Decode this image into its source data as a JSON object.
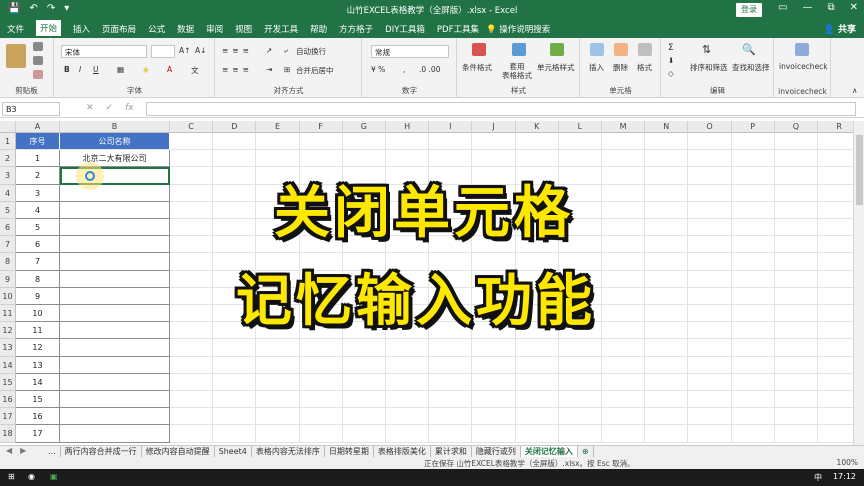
{
  "window": {
    "title": "山竹EXCEL表格教学（全屏版）.xlsx  -  Excel",
    "login_label": "登录",
    "controls": [
      "—",
      "▢",
      "⧉",
      "✕"
    ]
  },
  "menu": {
    "tabs": [
      "文件",
      "开始",
      "插入",
      "页面布局",
      "公式",
      "数据",
      "审阅",
      "视图",
      "开发工具",
      "帮助",
      "方方格子",
      "DIY工具箱",
      "PDF工具集"
    ],
    "active_tab": "开始",
    "search_label": "操作说明搜索",
    "share_label": "共享"
  },
  "ribbon": {
    "groups": {
      "clipboard": "剪贴板",
      "font": "字体",
      "alignment": "对齐方式",
      "number": "数字",
      "styles": "样式",
      "cells": "单元格",
      "editing": "编辑",
      "invoicecheck": "invoicecheck"
    },
    "font_name": "宋体",
    "number_format": "常规",
    "labels": {
      "wrap": "自动换行",
      "merge": "合并后居中",
      "cond_format": "条件格式",
      "table_format": "套用\n表格格式",
      "cell_style": "单元格样式",
      "insert": "插入",
      "delete": "删除",
      "format": "格式",
      "sort_filter": "排序和筛选",
      "find_select": "查找和选择",
      "invoicecheck_btn": "invoicecheck",
      "bold": "B",
      "italic": "I",
      "underline": "U"
    }
  },
  "formula_bar": {
    "name_box": "B3",
    "fx": "fx",
    "value": ""
  },
  "sheet": {
    "columns": [
      "A",
      "B",
      "C",
      "D",
      "E",
      "F",
      "G",
      "H",
      "I",
      "J",
      "K",
      "L",
      "M",
      "N",
      "O",
      "P",
      "Q",
      "R"
    ],
    "rows": [
      "1",
      "2",
      "3",
      "4",
      "5",
      "6",
      "7",
      "8",
      "9",
      "10",
      "11",
      "12",
      "13",
      "14",
      "15",
      "16",
      "17",
      "18"
    ],
    "table_header": {
      "a": "序号",
      "b": "公司名称"
    },
    "table_rows": [
      {
        "a": "1",
        "b": "北京二大有限公司"
      },
      {
        "a": "2",
        "b": ""
      },
      {
        "a": "3",
        "b": ""
      },
      {
        "a": "4",
        "b": ""
      },
      {
        "a": "5",
        "b": ""
      },
      {
        "a": "6",
        "b": ""
      },
      {
        "a": "7",
        "b": ""
      },
      {
        "a": "8",
        "b": ""
      },
      {
        "a": "9",
        "b": ""
      },
      {
        "a": "10",
        "b": ""
      },
      {
        "a": "11",
        "b": ""
      },
      {
        "a": "12",
        "b": ""
      },
      {
        "a": "13",
        "b": ""
      },
      {
        "a": "14",
        "b": ""
      },
      {
        "a": "15",
        "b": ""
      },
      {
        "a": "16",
        "b": ""
      },
      {
        "a": "17",
        "b": ""
      }
    ],
    "header_fill": "#4472c4"
  },
  "overlay": {
    "line1": "关闭单元格",
    "line2": "记忆输入功能"
  },
  "sheet_tabs": {
    "items": [
      "...",
      "两行内容合并成一行",
      "修改内容自动提醒",
      "Sheet4",
      "表格内容无法排序",
      "日期转星期",
      "表格排版美化",
      "累计求和",
      "隐藏行或列",
      "关闭记忆输入"
    ],
    "active": "关闭记忆输入",
    "add": "⊕"
  },
  "status": {
    "message": "正在保存 山竹EXCEL表格教学（全屏版）.xlsx。按 Esc 取消。",
    "zoom": "100%"
  },
  "taskbar": {
    "ime": "中",
    "clock": "17:12"
  },
  "colors": {
    "excel_green": "#217346",
    "overlay_yellow": "#ffe800"
  }
}
